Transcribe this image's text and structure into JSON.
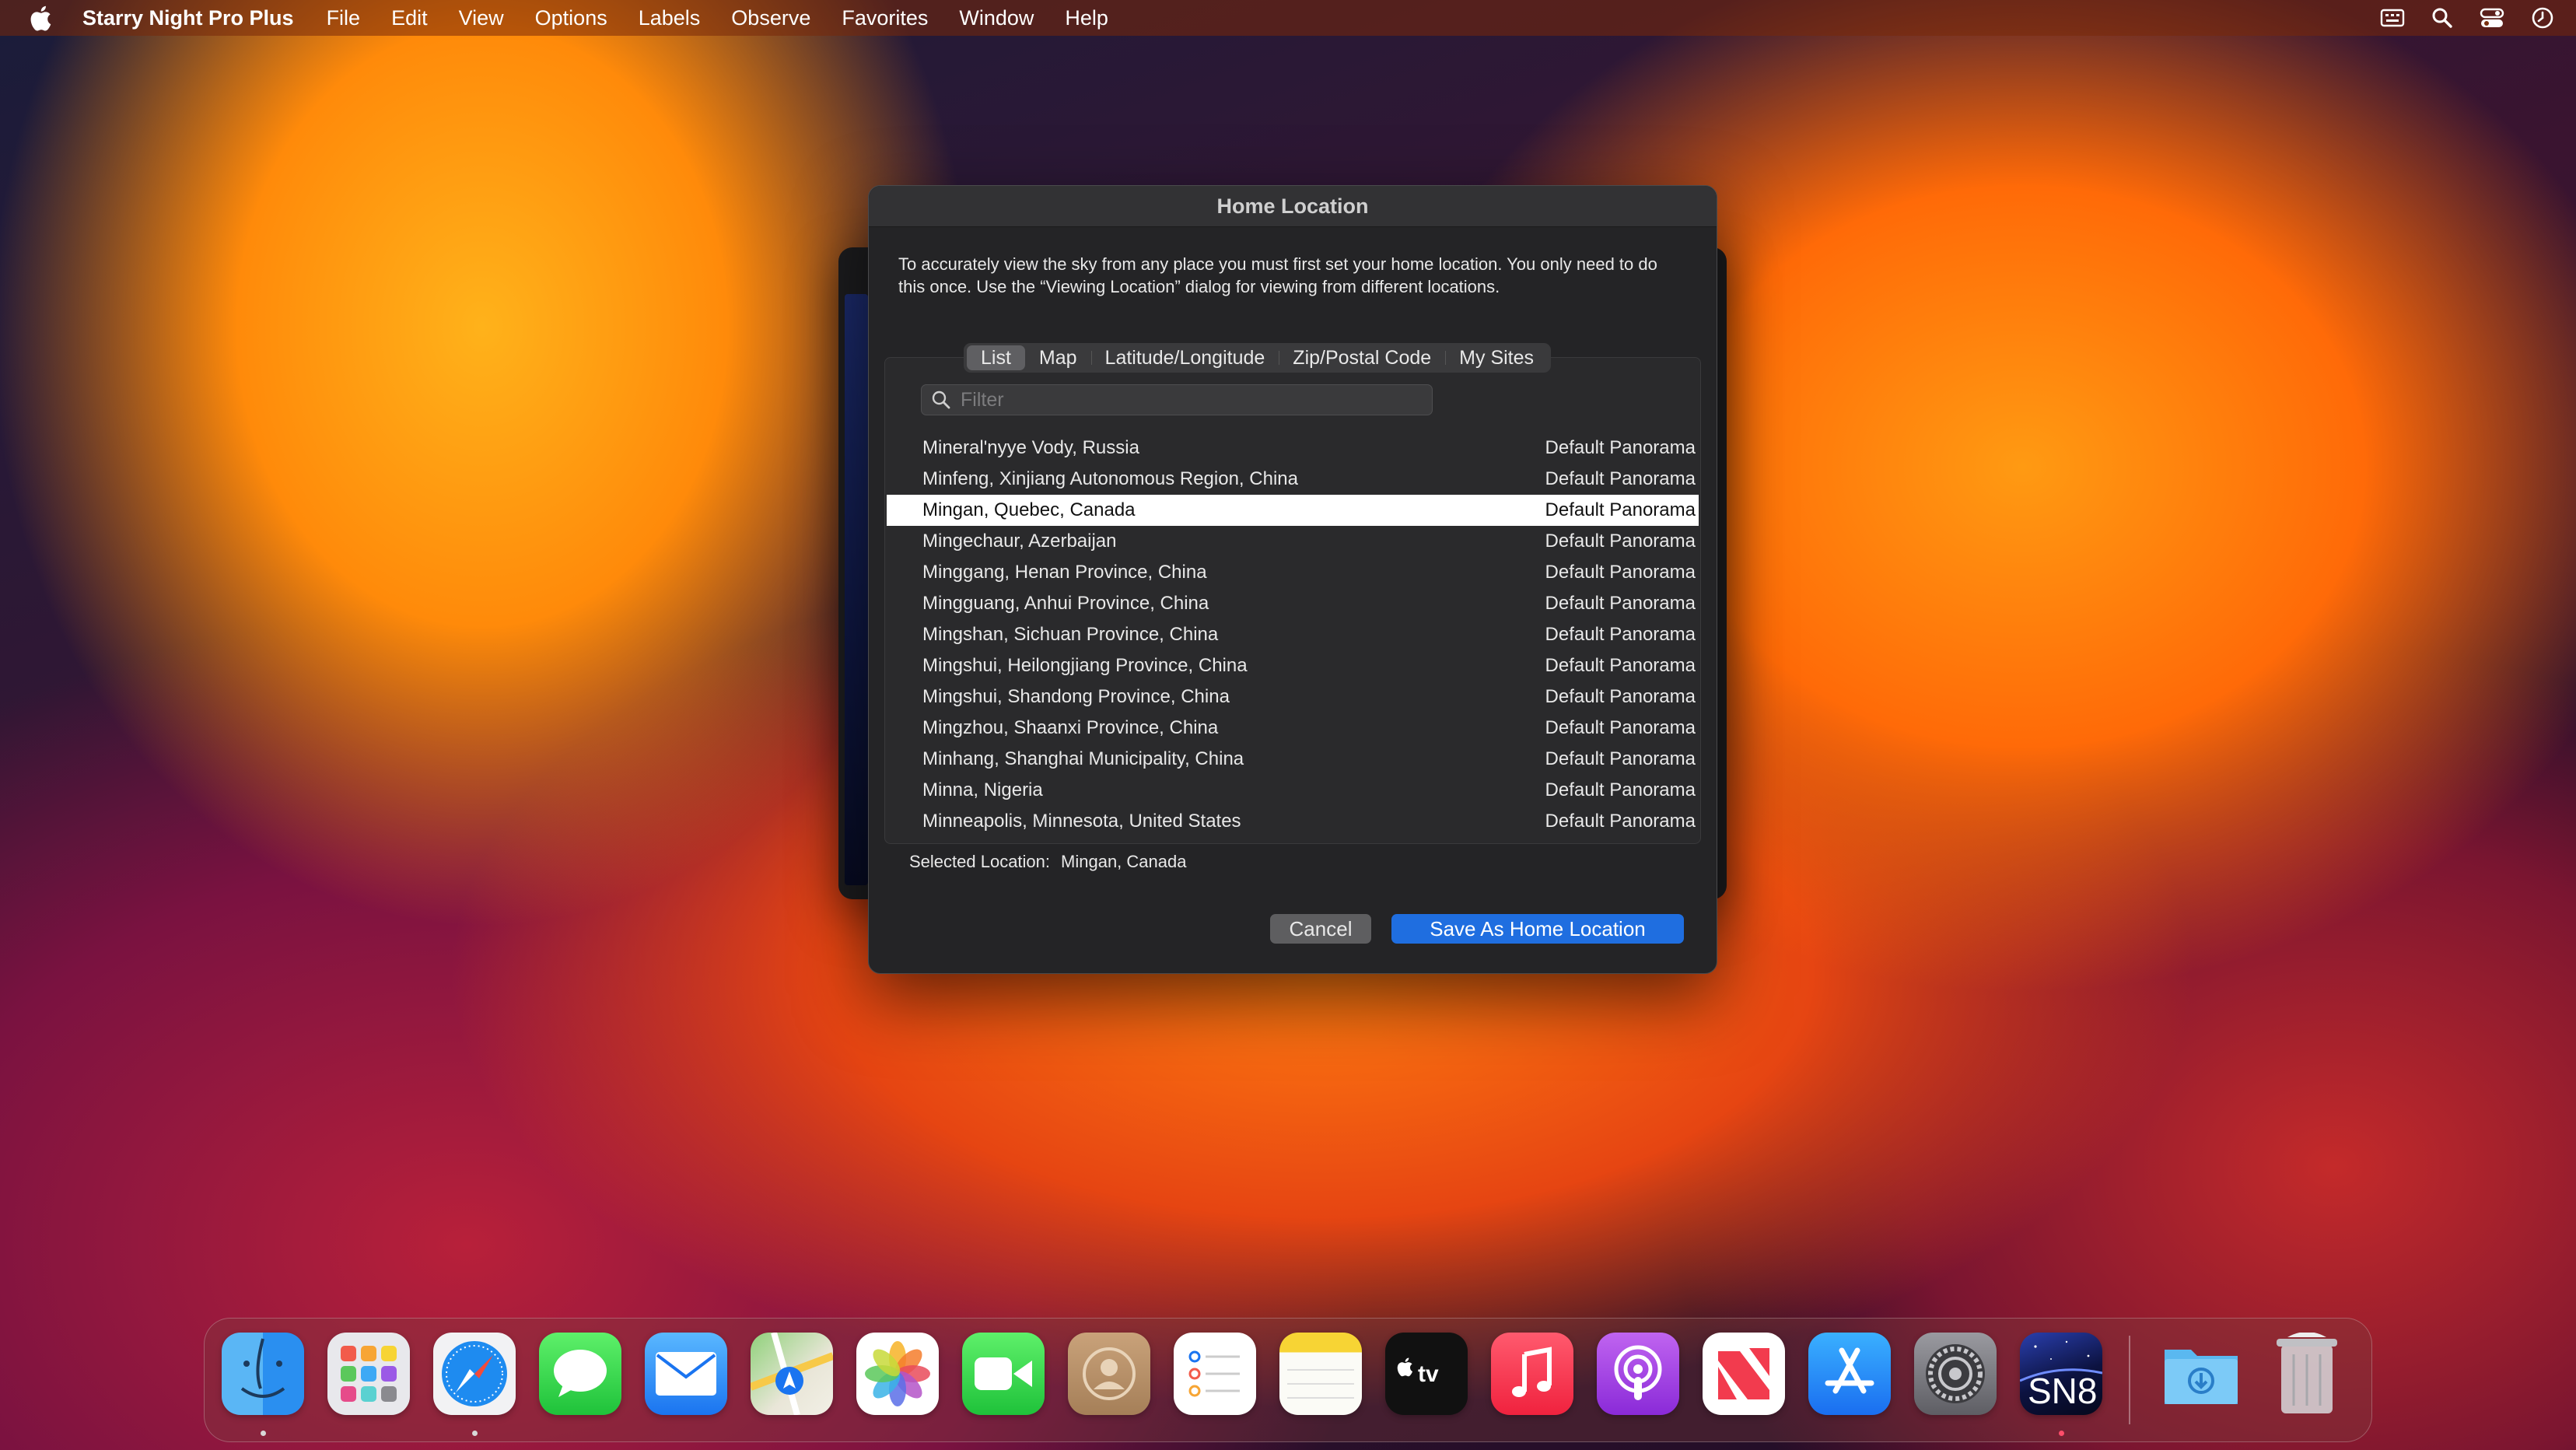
{
  "menubar": {
    "app_name": "Starry Night Pro Plus",
    "items": [
      "File",
      "Edit",
      "View",
      "Options",
      "Labels",
      "Observe",
      "Favorites",
      "Window",
      "Help"
    ],
    "right_icons": [
      "keyboard-layout-icon",
      "spotlight-search-icon",
      "control-center-icon",
      "clock-icon"
    ]
  },
  "dialog": {
    "title": "Home Location",
    "intro": "To accurately view the sky from any place you must first set your home location. You only need to do this once. Use the “Viewing Location” dialog for viewing from different locations.",
    "tabs": [
      "List",
      "Map",
      "Latitude/Longitude",
      "Zip/Postal Code",
      "My Sites"
    ],
    "active_tab": "List",
    "filter": {
      "placeholder": "Filter",
      "value": ""
    },
    "rows": [
      {
        "name": "Mineral'nyye Vody, Russia",
        "panorama": "Default Panorama"
      },
      {
        "name": "Minfeng, Xinjiang Autonomous Region, China",
        "panorama": "Default Panorama"
      },
      {
        "name": "Mingan, Quebec, Canada",
        "panorama": "Default Panorama"
      },
      {
        "name": "Mingechaur, Azerbaijan",
        "panorama": "Default Panorama"
      },
      {
        "name": "Minggang, Henan Province, China",
        "panorama": "Default Panorama"
      },
      {
        "name": "Mingguang, Anhui Province, China",
        "panorama": "Default Panorama"
      },
      {
        "name": "Mingshan, Sichuan Province, China",
        "panorama": "Default Panorama"
      },
      {
        "name": "Mingshui, Heilongjiang Province, China",
        "panorama": "Default Panorama"
      },
      {
        "name": "Mingshui, Shandong Province, China",
        "panorama": "Default Panorama"
      },
      {
        "name": "Mingzhou, Shaanxi Province, China",
        "panorama": "Default Panorama"
      },
      {
        "name": "Minhang, Shanghai Municipality, China",
        "panorama": "Default Panorama"
      },
      {
        "name": "Minna, Nigeria",
        "panorama": "Default Panorama"
      },
      {
        "name": "Minneapolis, Minnesota, United States",
        "panorama": "Default Panorama"
      }
    ],
    "selected_row_index": 2,
    "selected_label": "Selected Location:",
    "selected_value": "Mingan, Canada",
    "cancel_label": "Cancel",
    "save_label": "Save As Home Location"
  },
  "dock": {
    "apps": [
      "finder-icon",
      "launchpad-icon",
      "safari-icon",
      "messages-icon",
      "mail-icon",
      "maps-icon",
      "photos-icon",
      "facetime-icon",
      "contacts-icon",
      "reminders-icon",
      "notes-icon",
      "apple-tv-icon",
      "music-icon",
      "podcasts-icon",
      "news-icon",
      "app-store-icon",
      "system-settings-icon",
      "starry-night-icon",
      "downloads-folder-icon",
      "trash-icon"
    ],
    "starry_night_text": "SN8",
    "running_indicators": [
      "finder",
      "safari",
      "starry-night"
    ]
  },
  "colors": {
    "accent_blue": "#1f6ee0",
    "selection_row": "#ffffff",
    "dialog_bg": "#242426"
  }
}
